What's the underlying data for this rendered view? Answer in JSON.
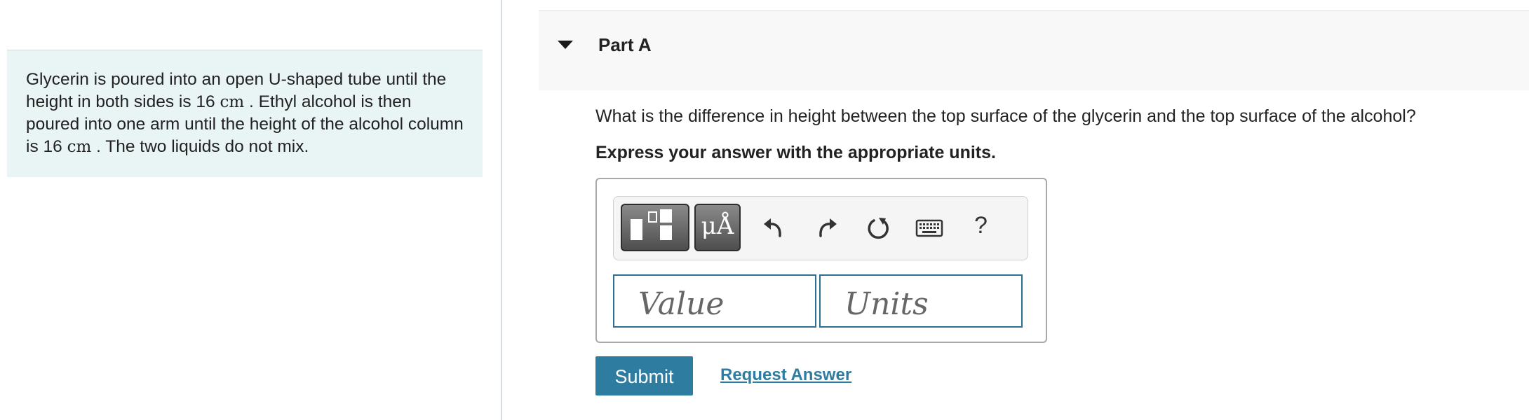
{
  "problem": {
    "text_1": "Glycerin is poured into an open U-shaped tube until the height in both sides is 16 ",
    "unit_1": "cm",
    "text_2": " . Ethyl alcohol is then poured into one arm until the height of the alcohol column is 16 ",
    "unit_2": "cm",
    "text_3": " . The two liquids do not mix."
  },
  "part": {
    "title": "Part A",
    "question": "What is the difference in height between the top surface of the glycerin and the top surface of the alcohol?",
    "instruction": "Express your answer with the appropriate units."
  },
  "toolbar": {
    "templates_icon": "templates-icon",
    "symbols_label": "μÅ",
    "undo_icon": "undo-icon",
    "redo_icon": "redo-icon",
    "reset_icon": "reset-icon",
    "keyboard_icon": "keyboard-icon",
    "help_label": "?"
  },
  "inputs": {
    "value_placeholder": "Value",
    "units_placeholder": "Units"
  },
  "actions": {
    "submit_label": "Submit",
    "request_answer_label": "Request Answer"
  },
  "colors": {
    "accent": "#2e7ca0",
    "problem_background": "#e9f4f5",
    "input_border": "#2d6f8e"
  }
}
